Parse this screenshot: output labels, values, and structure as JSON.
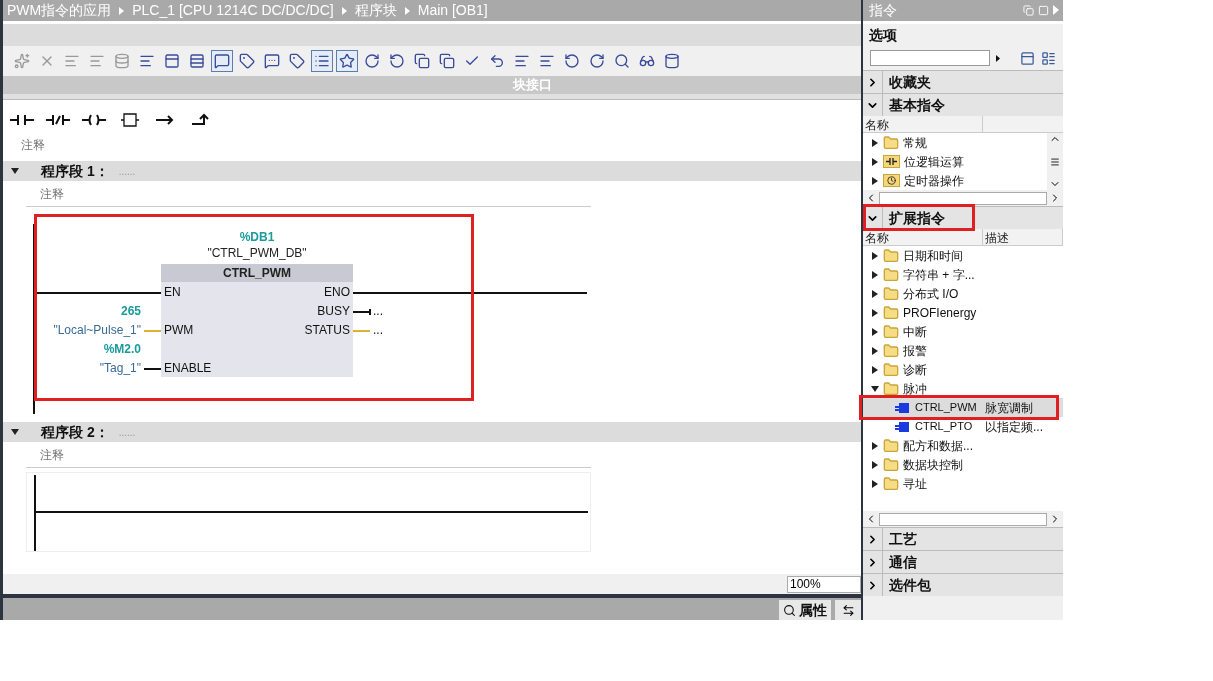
{
  "breadcrumb": [
    "PWM指令的应用",
    "PLC_1 [CPU 1214C DC/DC/DC]",
    "程序块",
    "Main [OB1]"
  ],
  "interface_bar": {
    "label": "块接口"
  },
  "block_comment": "注释",
  "networks": [
    {
      "title": "程序段 1：",
      "dots": "......",
      "expanded": true,
      "comment": "注释",
      "highlighted": true,
      "block": {
        "instance_address": "%DB1",
        "instance_name": "\"CTRL_PWM_DB\"",
        "name": "CTRL_PWM",
        "inputs": [
          {
            "pin": "EN",
            "kind": "power"
          },
          {
            "pin": "PWM",
            "kind": "data",
            "address": "265",
            "operand": "\"Local~Pulse_1\""
          },
          {
            "pin": "ENABLE",
            "kind": "bool",
            "address": "%M2.0",
            "operand": "\"Tag_1\""
          }
        ],
        "outputs": [
          {
            "pin": "ENO",
            "kind": "power"
          },
          {
            "pin": "BUSY",
            "kind": "bool",
            "operand": "..."
          },
          {
            "pin": "STATUS",
            "kind": "data",
            "operand": "..."
          }
        ]
      }
    },
    {
      "title": "程序段 2：",
      "dots": "......",
      "expanded": true,
      "comment": "注释"
    }
  ],
  "zoom": "100%",
  "bottom_tabs": [
    {
      "label": "属性"
    }
  ],
  "panel": {
    "title": "指令",
    "options_label": "选项",
    "sections": [
      {
        "title": "收藏夹",
        "expanded": false
      },
      {
        "title": "基本指令",
        "expanded": true,
        "columns": [
          "名称"
        ],
        "items": [
          {
            "name": "常规",
            "kind": "folder",
            "expanded": false
          },
          {
            "name": "位逻辑运算",
            "kind": "bit-folder",
            "expanded": false
          },
          {
            "name": "定时器操作",
            "kind": "timer-folder",
            "expanded": false
          }
        ]
      },
      {
        "title": "扩展指令",
        "expanded": true,
        "highlighted": true,
        "columns": [
          "名称",
          "描述"
        ],
        "items": [
          {
            "name": "日期和时间",
            "kind": "folder",
            "expanded": false
          },
          {
            "name": "字符串 + 字...",
            "kind": "folder",
            "expanded": false
          },
          {
            "name": "分布式 I/O",
            "kind": "folder",
            "expanded": false
          },
          {
            "name": "PROFIenergy",
            "kind": "folder",
            "expanded": false
          },
          {
            "name": "中断",
            "kind": "folder",
            "expanded": false
          },
          {
            "name": "报警",
            "kind": "folder",
            "expanded": false
          },
          {
            "name": "诊断",
            "kind": "folder",
            "expanded": false
          },
          {
            "name": "脉冲",
            "kind": "folder",
            "expanded": true,
            "children": [
              {
                "name": "CTRL_PWM",
                "description": "脉宽调制",
                "kind": "block",
                "selected": true,
                "highlighted": true
              },
              {
                "name": "CTRL_PTO",
                "description": "以指定频...",
                "kind": "block",
                "selected": false
              }
            ]
          },
          {
            "name": "配方和数据...",
            "kind": "folder",
            "expanded": false
          },
          {
            "name": "数据块控制",
            "kind": "folder",
            "expanded": false
          },
          {
            "name": "寻址",
            "kind": "folder",
            "expanded": false
          }
        ]
      },
      {
        "title": "工艺",
        "expanded": false
      },
      {
        "title": "通信",
        "expanded": false
      },
      {
        "title": "选件包",
        "expanded": false
      }
    ]
  }
}
